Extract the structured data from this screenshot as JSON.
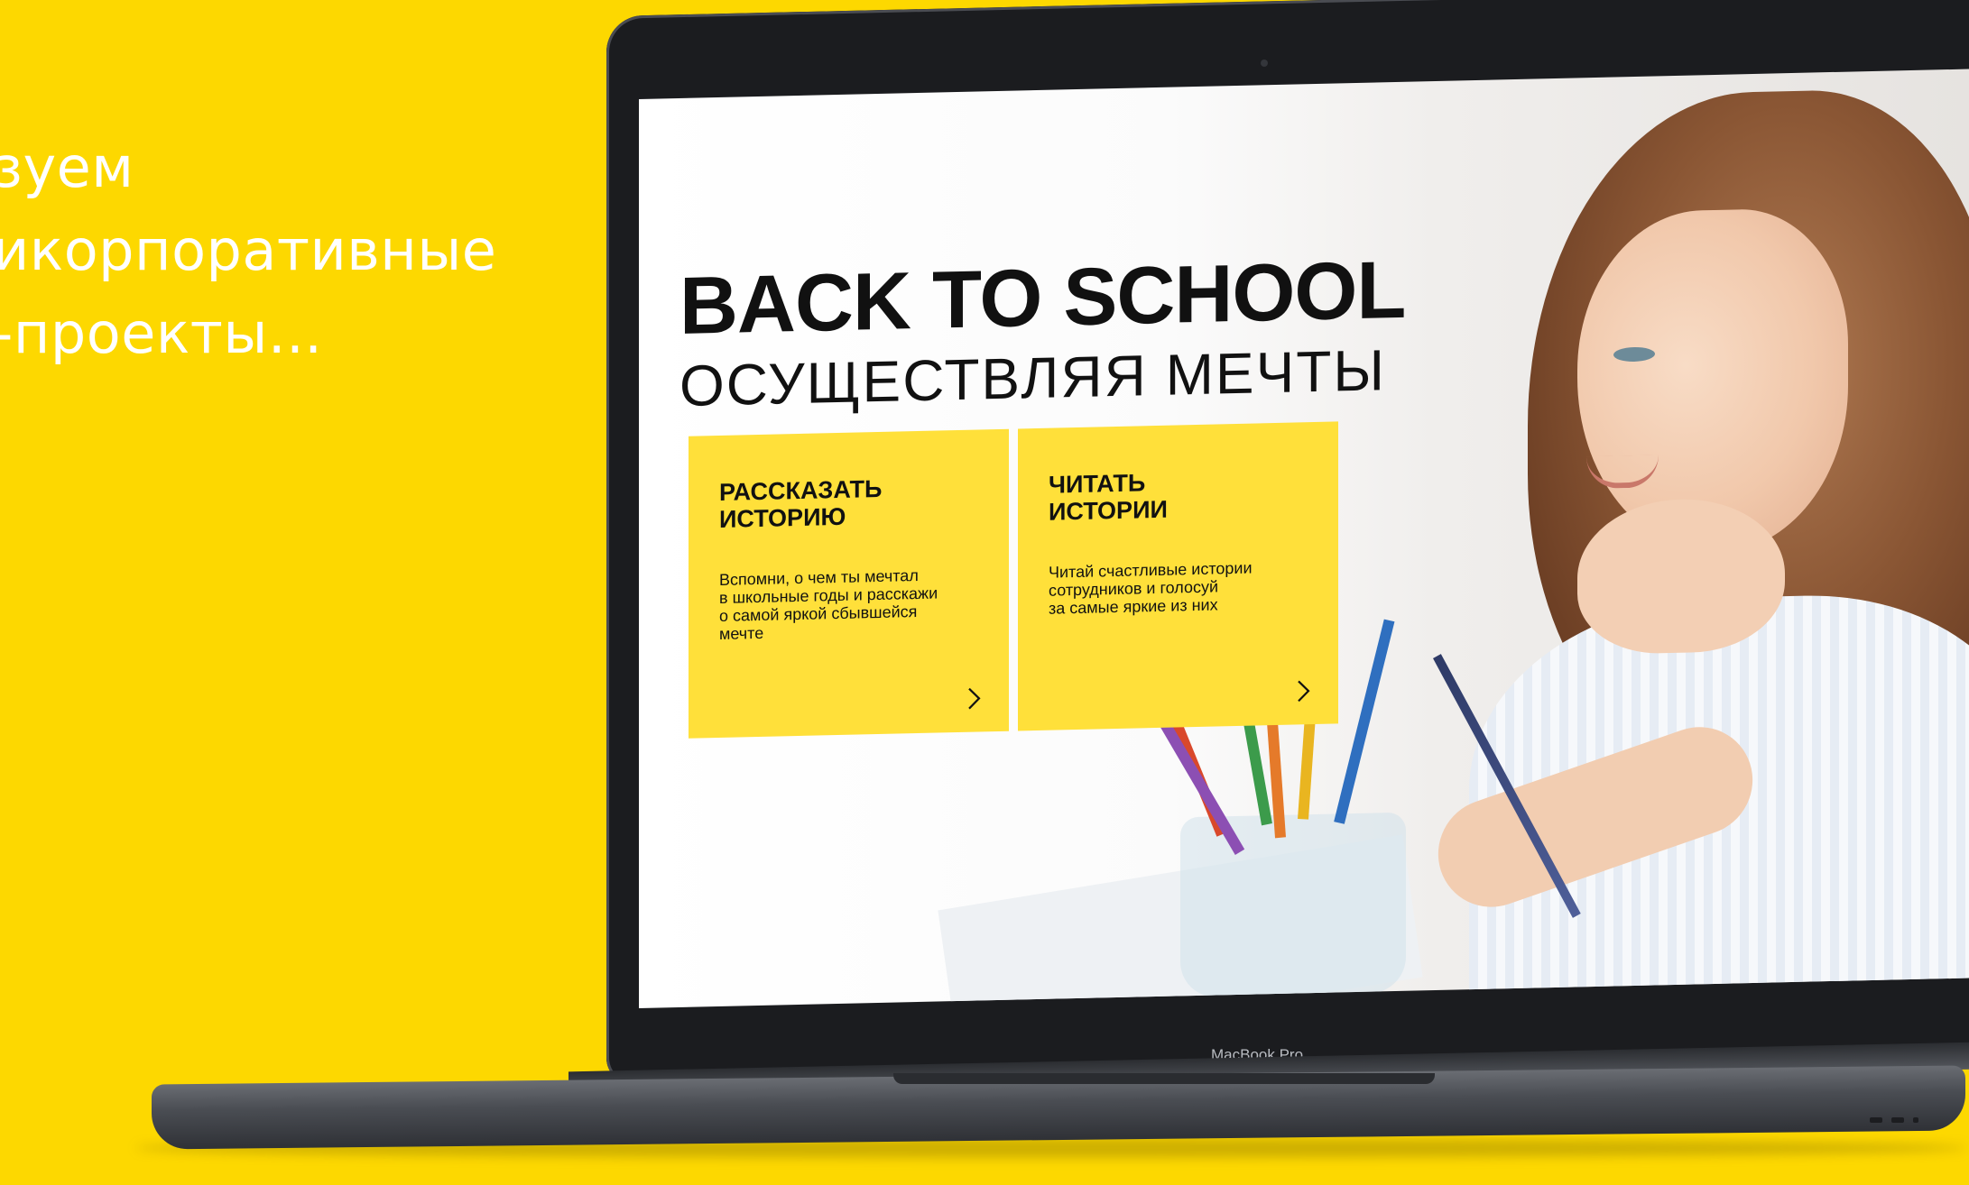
{
  "side_caption": {
    "lines": [
      "зуем",
      "икорпоративные",
      "-проекты..."
    ]
  },
  "colors": {
    "background": "#FDD800",
    "card": "#FFE03A",
    "laptop_frame": "#1b1c1f"
  },
  "laptop": {
    "brand_label": "MacBook Pro"
  },
  "site": {
    "title": "BACK TO SCHOOL",
    "subtitle": "ОСУЩЕСТВЛЯЯ  МЕЧТЫ",
    "cards": [
      {
        "title": "РАССКАЗАТЬ\nИСТОРИЮ",
        "text": "Вспомни, о чем ты мечтал\nв школьные годы и расскажи\nо самой яркой сбывшейся\nмечте",
        "icon": "chevron-right-icon"
      },
      {
        "title": "ЧИТАТЬ\nИСТОРИИ",
        "text": "Читай счастливые истории\nсотрудников и голосуй\nза самые яркие из них",
        "icon": "chevron-right-icon"
      }
    ]
  }
}
